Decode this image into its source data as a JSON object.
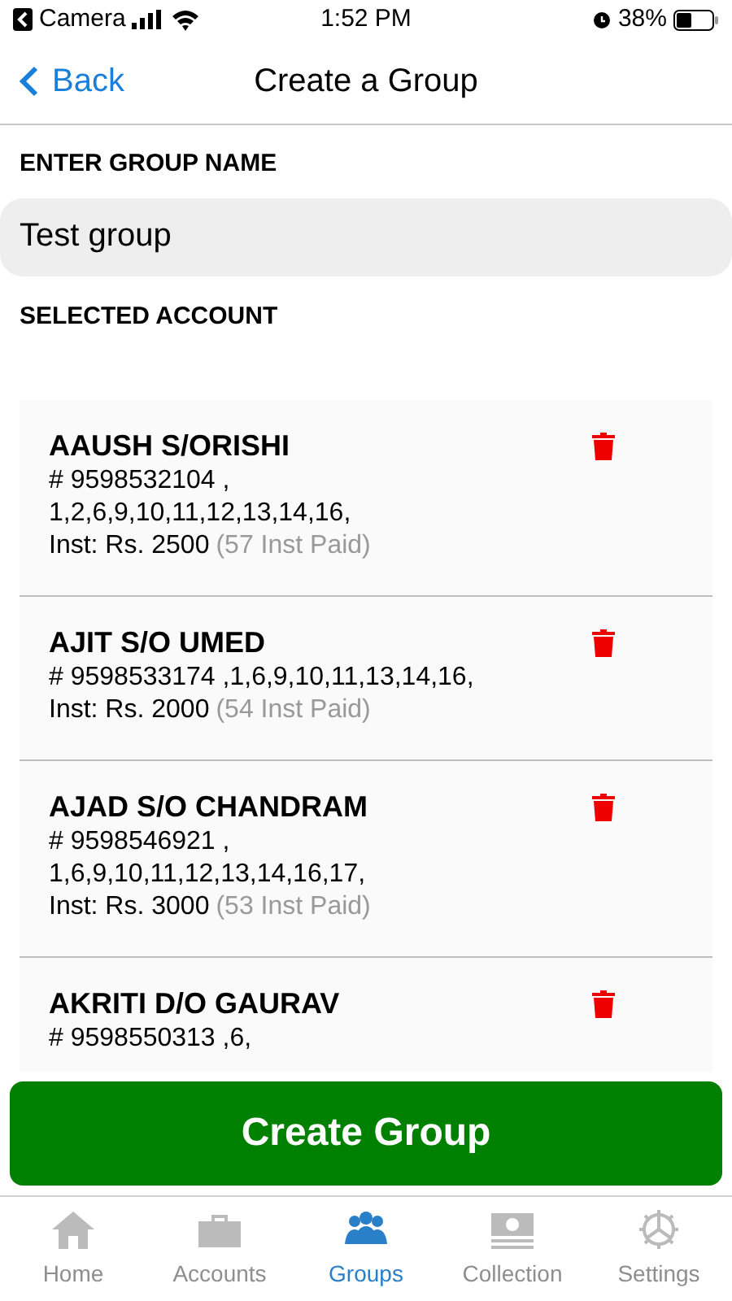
{
  "status_bar": {
    "back_app": "Camera",
    "time": "1:52 PM",
    "battery": "38%"
  },
  "nav": {
    "back": "Back",
    "title": "Create a Group"
  },
  "group_name": {
    "label": "ENTER GROUP NAME",
    "value": "Test group"
  },
  "accounts": {
    "label": "SELECTED ACCOUNT",
    "items": [
      {
        "name": "AAUSH S/ORISHI",
        "lines": [
          "# 9598532104 ,",
          "1,2,6,9,10,11,12,13,14,16,"
        ],
        "inst": "Inst: Rs. 2500",
        "paid": "(57 Inst Paid)"
      },
      {
        "name": "AJIT S/O UMED",
        "lines": [
          "# 9598533174 ,1,6,9,10,11,13,14,16,"
        ],
        "inst": "Inst: Rs. 2000",
        "paid": "(54 Inst Paid)"
      },
      {
        "name": "AJAD S/O CHANDRAM",
        "lines": [
          "# 9598546921 ,",
          "1,6,9,10,11,12,13,14,16,17,"
        ],
        "inst": "Inst: Rs. 3000",
        "paid": "(53 Inst Paid)"
      },
      {
        "name": "AKRITI D/O GAURAV",
        "lines": [
          "# 9598550313 ,6,"
        ]
      }
    ]
  },
  "create_button": "Create Group",
  "tabs": [
    {
      "label": "Home",
      "kind": "home",
      "selected": false
    },
    {
      "label": "Accounts",
      "kind": "briefcase",
      "selected": false
    },
    {
      "label": "Groups",
      "kind": "people",
      "selected": true
    },
    {
      "label": "Collection",
      "kind": "money",
      "selected": false
    },
    {
      "label": "Settings",
      "kind": "gear",
      "selected": false
    }
  ]
}
